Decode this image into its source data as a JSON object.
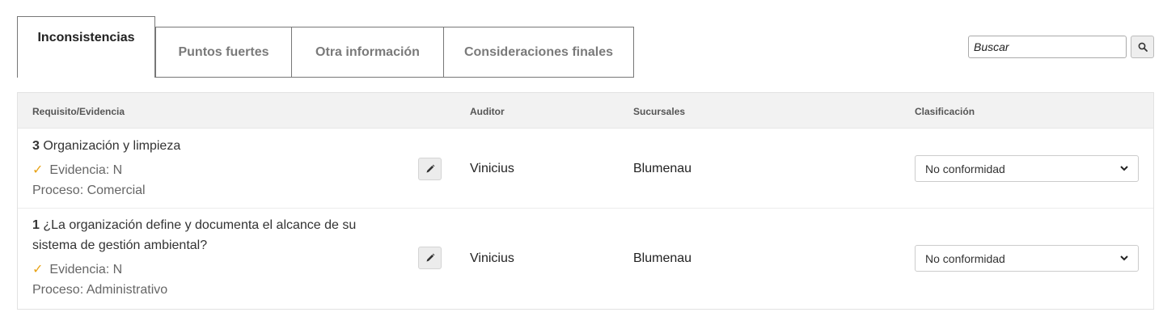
{
  "tabs": [
    {
      "label": "Inconsistencias",
      "active": true
    },
    {
      "label": "Puntos fuertes",
      "active": false
    },
    {
      "label": "Otra información",
      "active": false
    },
    {
      "label": "Consideraciones finales",
      "active": false
    }
  ],
  "search": {
    "placeholder": "Buscar",
    "value": "",
    "icon": "search-icon"
  },
  "table": {
    "headers": {
      "requirement": "Requisito/Evidencia",
      "auditor": "Auditor",
      "branches": "Sucursales",
      "classification": "Clasificación"
    },
    "rows": [
      {
        "number": "3",
        "requirement": "Organización y limpieza",
        "evidence": "Evidencia: N",
        "process": "Proceso: Comercial",
        "auditor": "Vinicius",
        "branch": "Blumenau",
        "classification": "No conformidad"
      },
      {
        "number": "1",
        "requirement": "¿La organización define y documenta el alcance de su sistema de gestión ambiental?",
        "evidence": "Evidencia: N",
        "process": "Proceso: Administrativo",
        "auditor": "Vinicius",
        "branch": "Blumenau",
        "classification": "No conformidad"
      }
    ]
  },
  "colors": {
    "check": "#e8a317",
    "header_bg": "#f2f2f2",
    "tab_border": "#777777"
  }
}
